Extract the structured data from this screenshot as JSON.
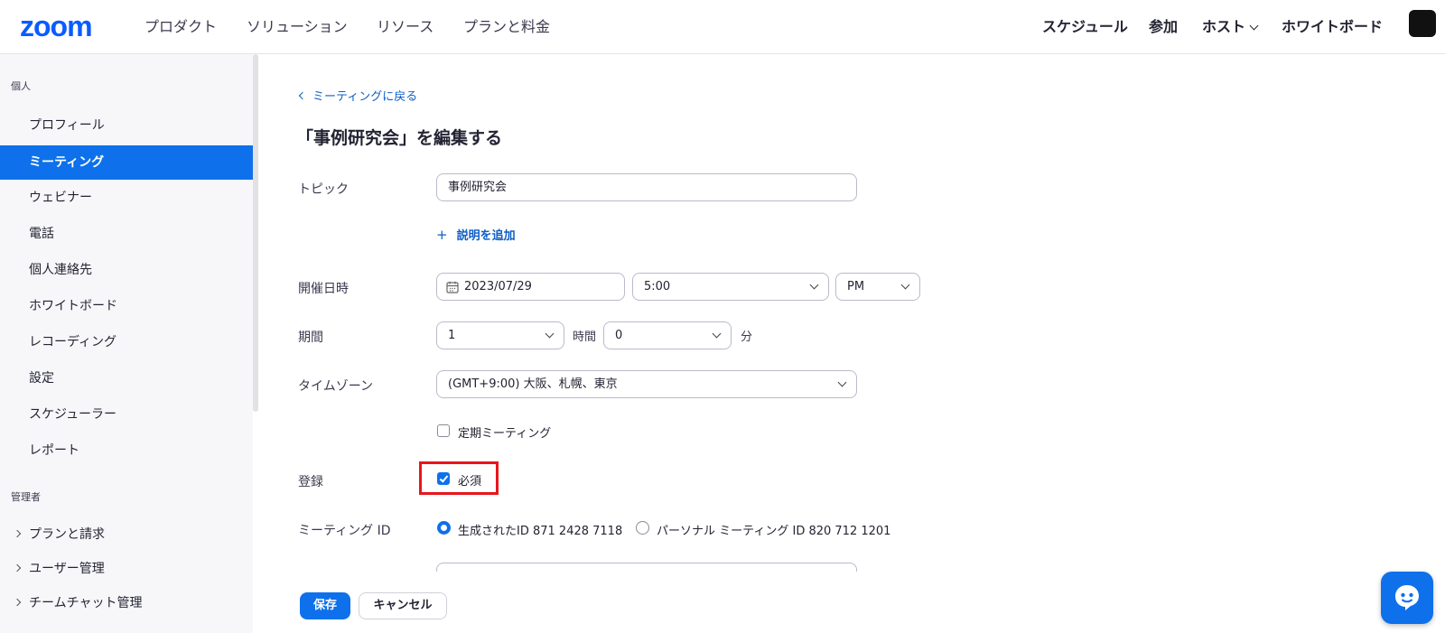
{
  "brand": {
    "logo_text": "zoom",
    "accent": "#0b5cff",
    "primary": "#0e71eb",
    "highlight": "#e8161b"
  },
  "topnav": {
    "left_items": [
      "プロダクト",
      "ソリューション",
      "リソース",
      "プランと料金"
    ],
    "right_items": [
      "スケジュール",
      "参加",
      "ホスト",
      "ホワイトボード"
    ]
  },
  "sidebar": {
    "personal_title": "個人",
    "personal_items": [
      {
        "label": "プロフィール",
        "active": false
      },
      {
        "label": "ミーティング",
        "active": true
      },
      {
        "label": "ウェビナー",
        "active": false
      },
      {
        "label": "電話",
        "active": false
      },
      {
        "label": "個人連絡先",
        "active": false
      },
      {
        "label": "ホワイトボード",
        "active": false
      },
      {
        "label": "レコーディング",
        "active": false
      },
      {
        "label": "設定",
        "active": false
      },
      {
        "label": "スケジューラー",
        "active": false
      },
      {
        "label": "レポート",
        "active": false
      }
    ],
    "admin_title": "管理者",
    "admin_items": [
      "プランと請求",
      "ユーザー管理",
      "チームチャット管理"
    ]
  },
  "main": {
    "back_link": "ミーティングに戻る",
    "title": "「事例研究会」を編集する",
    "topic": {
      "label": "トピック",
      "value": "事例研究会"
    },
    "add_description": "説明を追加",
    "datetime": {
      "label": "開催日時",
      "date": "2023/07/29",
      "time": "5:00",
      "ampm": "PM"
    },
    "duration": {
      "label": "期間",
      "hours": "1",
      "hours_unit": "時間",
      "minutes": "0",
      "minutes_unit": "分"
    },
    "timezone": {
      "label": "タイムゾーン",
      "value": "(GMT+9:00) 大阪、札幌、東京"
    },
    "recurring": {
      "label": "定期ミーティング",
      "checked": false
    },
    "registration": {
      "label": "登録",
      "option": "必須",
      "checked": true
    },
    "meeting_id": {
      "label": "ミーティング ID",
      "generated": "生成されたID 871 2428 7118",
      "personal": "パーソナル ミーティング ID 820 712 1201",
      "selected": "generated"
    },
    "save": "保存",
    "cancel": "キャンセル"
  }
}
